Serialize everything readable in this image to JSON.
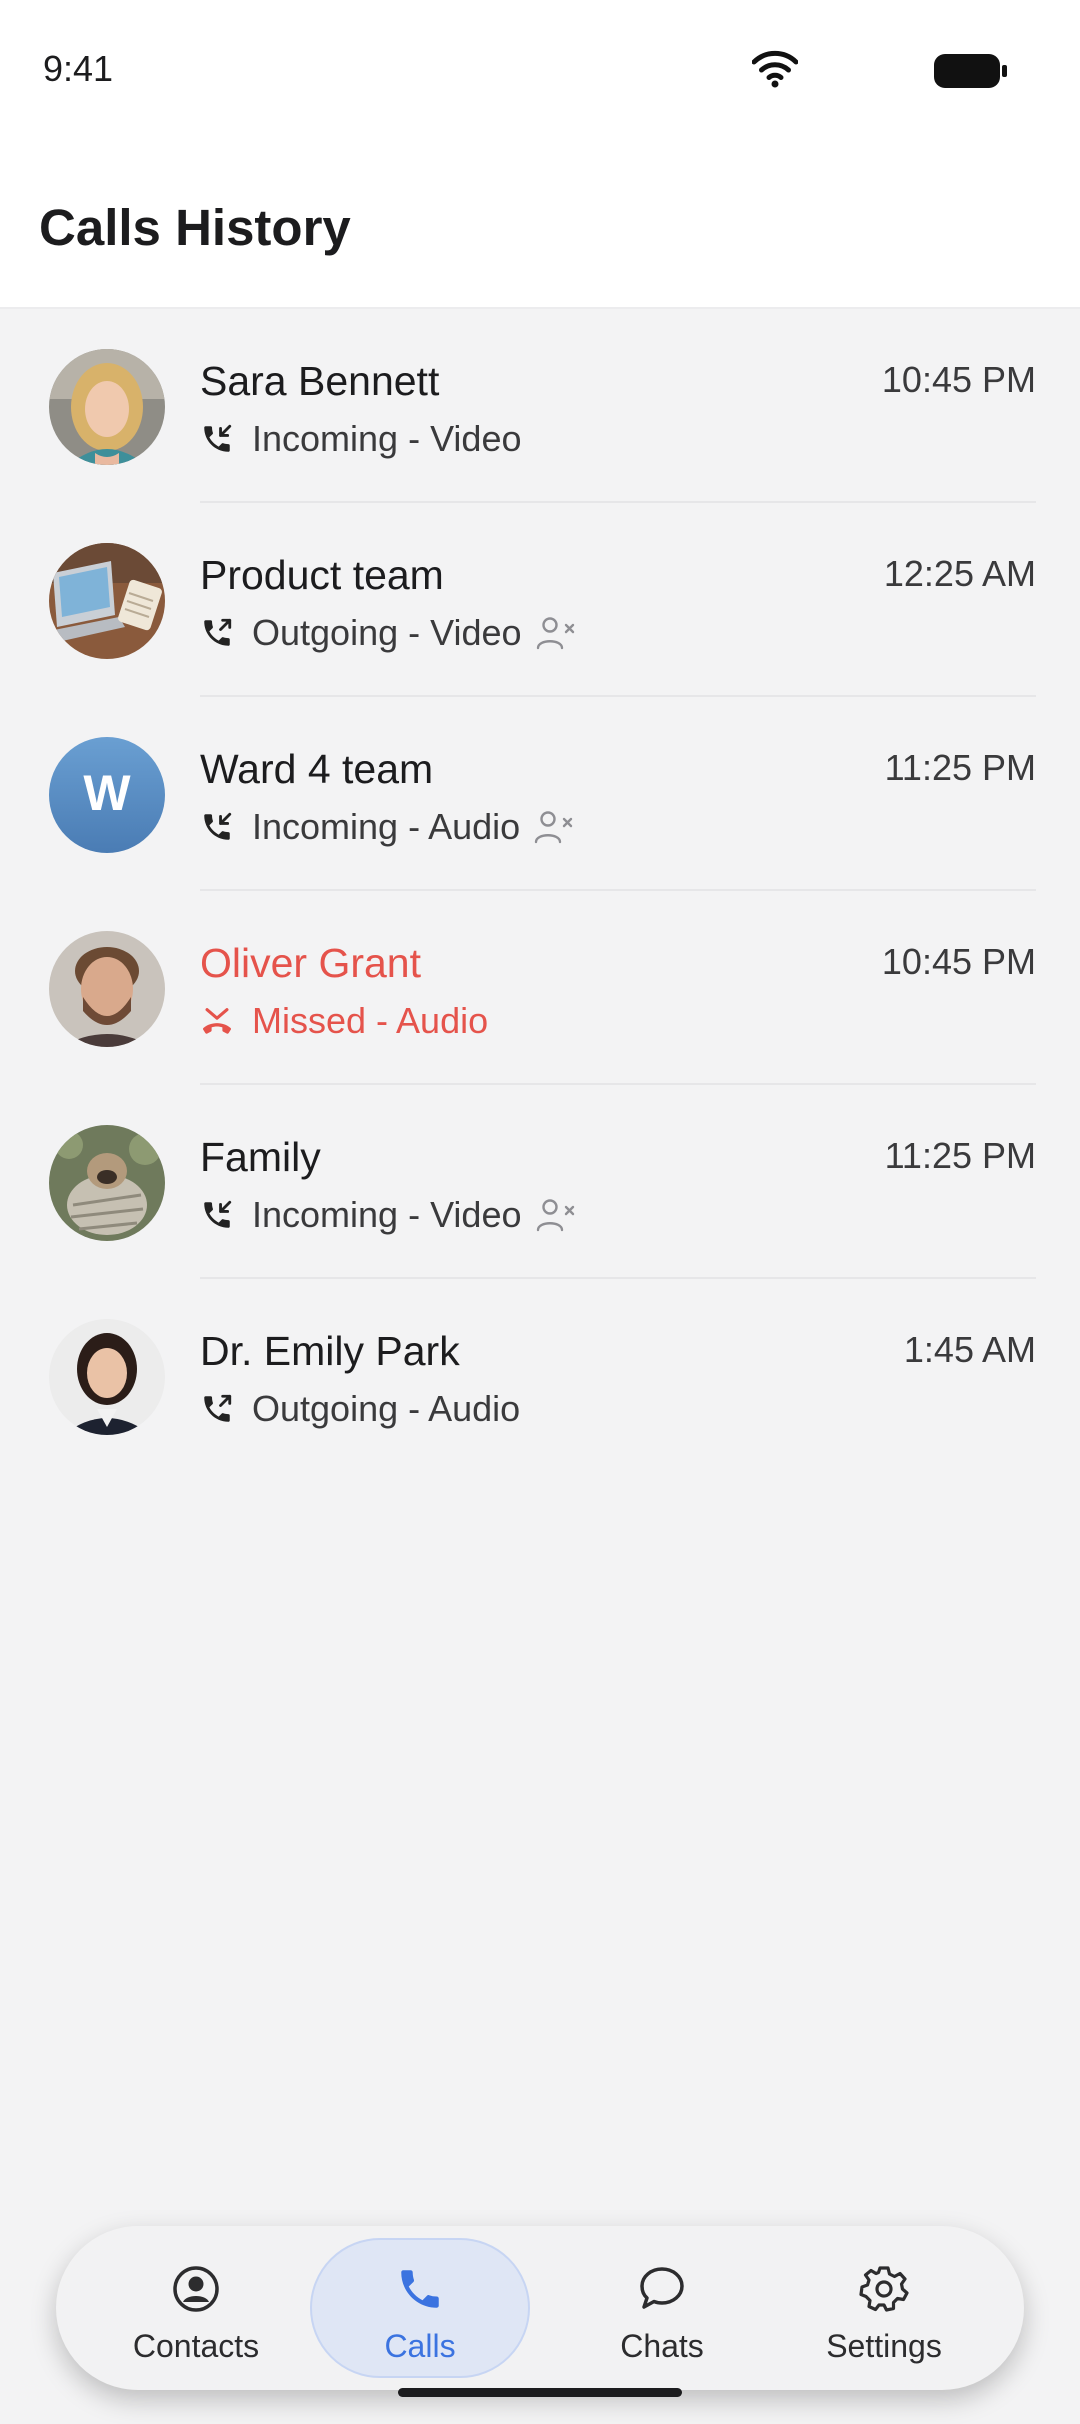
{
  "status_bar": {
    "time": "9:41"
  },
  "header": {
    "title": "Calls History"
  },
  "calls": [
    {
      "name": "Sara Bennett",
      "detail": "Incoming - Video",
      "time": "10:45 PM",
      "direction": "incoming",
      "group": false,
      "missed": false,
      "avatar": "photo-woman-blonde"
    },
    {
      "name": "Product team",
      "detail": "Outgoing - Video",
      "time": "12:25 AM",
      "direction": "outgoing",
      "group": true,
      "missed": false,
      "avatar": "photo-laptop-desk"
    },
    {
      "name": "Ward 4 team",
      "detail": "Incoming - Audio",
      "time": "11:25 PM",
      "direction": "incoming",
      "group": true,
      "missed": false,
      "avatar": "initial",
      "initial": "W"
    },
    {
      "name": "Oliver Grant",
      "detail": "Missed - Audio",
      "time": "10:45 PM",
      "direction": "missed",
      "group": false,
      "missed": true,
      "avatar": "photo-man-beard"
    },
    {
      "name": "Family",
      "detail": "Incoming - Video",
      "time": "11:25 PM",
      "direction": "incoming",
      "group": true,
      "missed": false,
      "avatar": "photo-pug-blanket"
    },
    {
      "name": "Dr. Emily Park",
      "detail": "Outgoing - Audio",
      "time": "1:45 AM",
      "direction": "outgoing",
      "group": false,
      "missed": false,
      "avatar": "photo-woman-dark-hair"
    }
  ],
  "tabs": [
    {
      "label": "Contacts",
      "icon": "person-circle-icon",
      "active": false
    },
    {
      "label": "Calls",
      "icon": "phone-icon",
      "active": true
    },
    {
      "label": "Chats",
      "icon": "chat-bubble-icon",
      "active": false
    },
    {
      "label": "Settings",
      "icon": "gear-icon",
      "active": false
    }
  ],
  "colors": {
    "accent": "#3b73e0",
    "missed": "#e5534b",
    "background": "#f3f3f4"
  }
}
